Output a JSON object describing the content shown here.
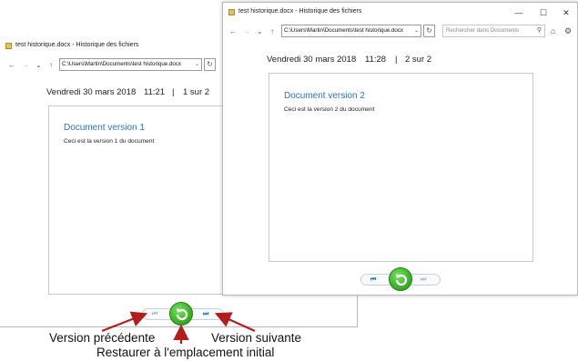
{
  "back_window": {
    "title": "test historique.docx - Historique des fichiers",
    "address": "C:\\Users\\Martin\\Documents\\test historique.docx",
    "date": "Vendredi 30 mars 2018",
    "time": "11:21",
    "separator": "|",
    "counter": "1 sur 2",
    "doc_heading": "Document version 1",
    "doc_text": "Ceci est la version 1 du document"
  },
  "front_window": {
    "title": "test historique.docx - Historique des fichiers",
    "address": "C:\\Users\\Martin\\Documents\\test historique.docx",
    "search_placeholder": "Rechercher dans Documents",
    "date": "Vendredi 30 mars 2018",
    "time": "11:28",
    "separator": "|",
    "counter": "2 sur 2",
    "doc_heading": "Document version 2",
    "doc_text": "Ceci est la version 2 du document",
    "controls": {
      "minimize": "—",
      "maximize": "☐",
      "close": "✕"
    }
  },
  "nav_glyphs": {
    "back": "←",
    "forward": "→",
    "recent": "⌄",
    "up": "↑",
    "refresh": "↻",
    "dropdown": "⌄",
    "search": "⚲",
    "home": "⌂",
    "settings": "⚙",
    "previous": "⏮",
    "next": "⏭"
  },
  "callouts": {
    "previous": "Version précédente",
    "restore": "Restaurer à l'emplacement initial",
    "next": "Version suivante"
  },
  "colors": {
    "heading_blue": "#2e74b5",
    "restore_green": "#3fb52a",
    "arrow_red": "#b01e1e"
  }
}
